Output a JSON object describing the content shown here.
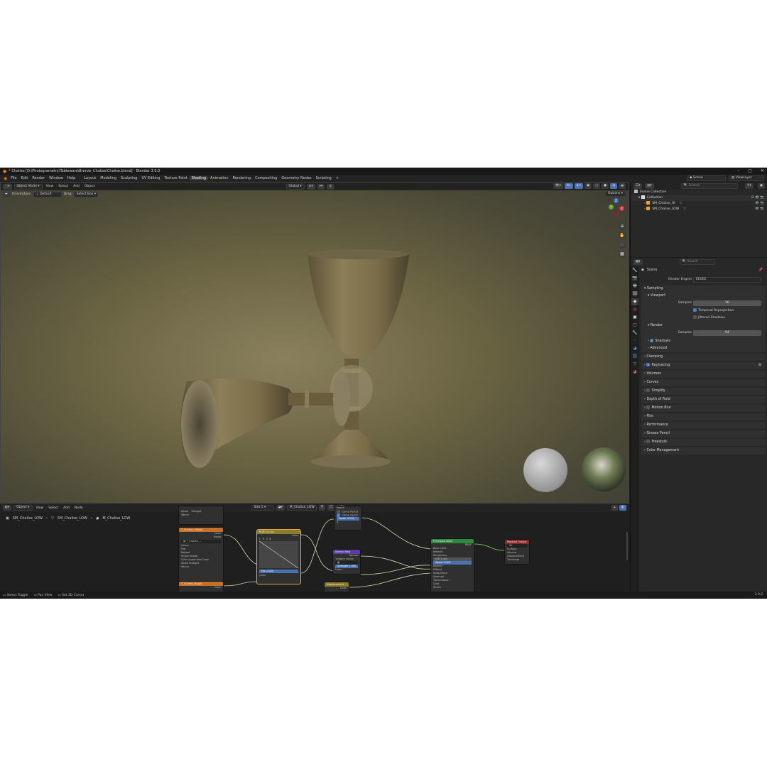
{
  "window": {
    "title": "* Chalise [D:\\Photogrametry\\Tableware\\Bronze_Chalise\\Chalise.blend] - Blender 3.0.0",
    "buttons": [
      "–",
      "▢",
      "✕"
    ]
  },
  "menubar": {
    "menus": [
      "File",
      "Edit",
      "Render",
      "Window",
      "Help"
    ],
    "workspaces": [
      "Layout",
      "Modeling",
      "Sculpting",
      "UV Editing",
      "Texture Paint",
      "Shading",
      "Animation",
      "Rendering",
      "Compositing",
      "Geometry Nodes",
      "Scripting"
    ],
    "active_workspace": "Shading",
    "add_workspace": "+",
    "scene_label": "Scene",
    "viewlayer_label": "ViewLayer"
  },
  "viewport": {
    "mode": "Object Mode",
    "menus": [
      "View",
      "Select",
      "Add",
      "Object"
    ],
    "transform_orientation": "Global",
    "orientation_label": "Orientation:",
    "orientation_value": "Default",
    "drag_label": "Drag",
    "drag_value": "Select Box",
    "options_label": "Options",
    "gizmo": {
      "x": "X",
      "y": "Y",
      "z": "Z"
    }
  },
  "node_editor": {
    "editor_type": "Object",
    "menus": [
      "View",
      "Select",
      "Add",
      "Node"
    ],
    "slot": "Slot 1",
    "material": "M_Chalise_LOW",
    "breadcrumb": [
      "SM_Chalise_LOW",
      "SM_Chalise_LOW",
      "M_Chalise_LOW"
    ],
    "nodes": {
      "image_tex_a": {
        "title": "T_Chalise_Albedo",
        "rows": [
          "Color",
          "Alpha",
          "Linear",
          "Flat",
          "Repeat",
          "Single Image",
          "Color Space  Non-Color",
          "Alpha  Straight",
          "Vector"
        ]
      },
      "image_tex_b": {
        "title": "T_Chalise_Rough",
        "rows": [
          "Color",
          "Alpha"
        ]
      },
      "rgb_curves": {
        "title": "RGB Curves",
        "rows": [
          "Color",
          "Fac  1.000",
          "Color"
        ]
      },
      "normal_map": {
        "title": "Normal Map",
        "rows": [
          "Normal",
          "Tangent Space",
          "Strength  1.000",
          "Color"
        ]
      },
      "mix_top": {
        "title": "Mix",
        "rows": [
          "Result",
          "Clamp Result",
          "Clamp Factor",
          "Factor  0.500",
          "A",
          "B"
        ]
      },
      "principled": {
        "title": "Principled BSDF",
        "rows": [
          "BSDF",
          "Base Color",
          "Metallic",
          "Roughness",
          "IOR  1.450",
          "Alpha  1.000",
          "Normal",
          "Diffuse",
          "Subsurface",
          "Specular",
          "Transmission",
          "Coat",
          "Sheen",
          "Emission"
        ]
      },
      "output": {
        "title": "Material Output",
        "rows": [
          "All",
          "Surface",
          "Volume",
          "Displacement",
          "Thickness"
        ]
      },
      "displacement": {
        "title": "Displacement",
        "rows": [
          "Color"
        ]
      }
    }
  },
  "outliner": {
    "search_placeholder": "Search",
    "root": "Scene Collection",
    "collection": "Collection",
    "objects": [
      "SM_Chalise_HI",
      "SM_Chalise_LOW"
    ]
  },
  "properties": {
    "search_placeholder": "Search",
    "context": "Scene",
    "render_engine_label": "Render Engine",
    "render_engine": "EEVEE",
    "sampling": {
      "title": "Sampling",
      "viewport_title": "Viewport",
      "viewport_samples_label": "Samples",
      "viewport_samples": "16",
      "temporal_reprojection": "Temporal Reprojection",
      "jittered_shadows": "Jittered Shadows",
      "render_title": "Render",
      "render_samples_label": "Samples",
      "render_samples": "64",
      "shadows": "Shadows",
      "advanced": "Advanced"
    },
    "panels": [
      "Clamping",
      "Raytracing",
      "Volumes",
      "Curves",
      "Simplify",
      "Depth of Field",
      "Motion Blur",
      "Film",
      "Performance",
      "Grease Pencil",
      "Freestyle",
      "Color Management"
    ]
  },
  "statusbar": {
    "items": [
      "Select Toggle",
      "Pan View",
      "Set 3D Cursor"
    ],
    "version": "3.0.0"
  },
  "colors": {
    "accent": "#4772b3",
    "node_image": "#c46f2a",
    "node_color": "#8d7d2a",
    "node_vector": "#5a3fa0",
    "node_shader": "#2b8a3e",
    "node_output": "#8a2a2a"
  }
}
